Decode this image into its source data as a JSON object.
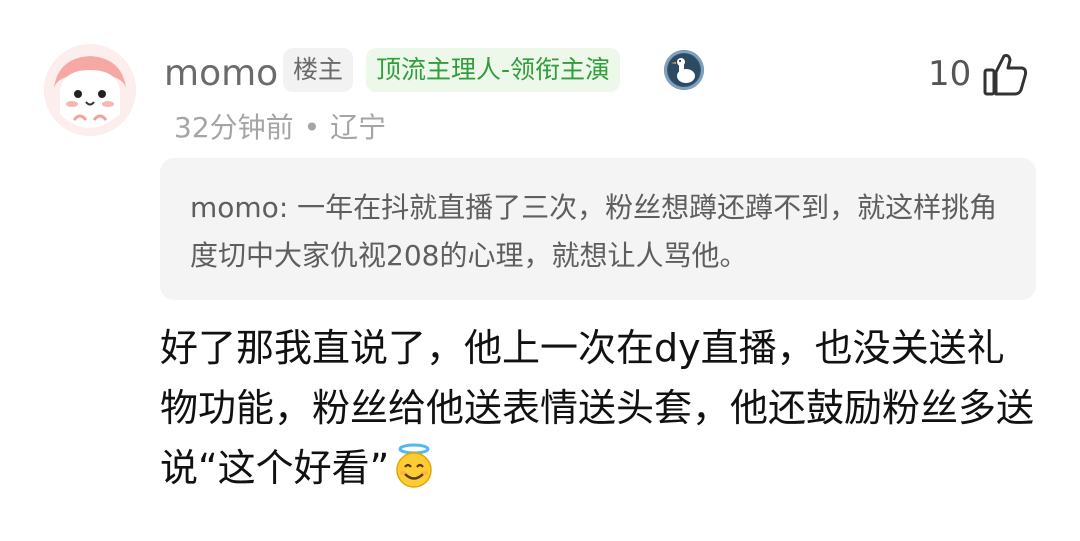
{
  "comment": {
    "username": "momo",
    "host_tag": "楼主",
    "title_tag": "顶流主理人-领衔主演",
    "badge_icon": "goose-badge-icon",
    "likes": "10",
    "time": "32分钟前",
    "location": "辽宁",
    "separator": "•",
    "quote": "momo: 一年在抖就直播了三次，粉丝想蹲还蹲不到，就这样挑角度切中大家仇视208的心理，就想让人骂他。",
    "body": "好了那我直说了，他上一次在dy直播，也没关送礼物功能，粉丝给他送表情送头套，他还鼓励粉丝多送说“这个好看”",
    "emoji": "smiling-face-with-halo"
  },
  "colors": {
    "green_tag_bg": "#eef8ea",
    "green_tag_text": "#2f9e3b",
    "gray_tag_bg": "#f2f2f2",
    "quote_bg": "#f4f4f4"
  }
}
